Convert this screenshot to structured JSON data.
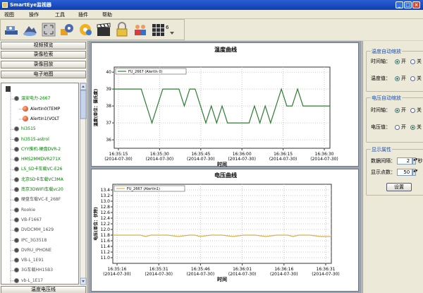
{
  "window": {
    "title": "SmartEye监视器",
    "minimize": "_",
    "maximize": "□",
    "close": "×"
  },
  "menu": [
    "视图",
    "操作",
    "工具",
    "插件",
    "帮助"
  ],
  "toolbar": {
    "icons": [
      "camera-icon",
      "cloud-icon",
      "fullscreen-icon",
      "gear-icon",
      "film-clapper-icon",
      "lock-icon",
      "users-icon",
      "grid-icon"
    ],
    "grid_badge": "6"
  },
  "nav": {
    "buttons": [
      "视频预览",
      "录像检索",
      "录像回放",
      "电子地图"
    ],
    "bottom_tab": "温度电压线"
  },
  "tree": {
    "items": [
      {
        "label": "",
        "kind": "pc",
        "color": "#000000",
        "indent": 0
      },
      {
        "label": "温安电力-2667",
        "kind": "cam",
        "color": "#008000",
        "indent": 1
      },
      {
        "label": "AlertIn0(TEMP",
        "kind": "alarm",
        "color": "#000000",
        "indent": 2
      },
      {
        "label": "AlertIn1(VOLT",
        "kind": "alarm",
        "color": "#000000",
        "indent": 2
      },
      {
        "label": "hi3515",
        "kind": "cam",
        "color": "#008000",
        "indent": 1
      },
      {
        "label": "hi3515-astrol",
        "kind": "cam",
        "color": "#008000",
        "indent": 1
      },
      {
        "label": "CYY推机-硬盘DVR-2",
        "kind": "cam",
        "color": "#008000",
        "indent": 1
      },
      {
        "label": "HMS2MMDVR271X",
        "kind": "cam",
        "color": "#008000",
        "indent": 1
      },
      {
        "label": "LS_SD卡车载VC-E26",
        "kind": "cam",
        "color": "#008000",
        "indent": 1
      },
      {
        "label": "北京SD卡车载VC3MA",
        "kind": "cam",
        "color": "#008000",
        "indent": 1
      },
      {
        "label": "南京3DWIFI车载vc20",
        "kind": "cam",
        "color": "#008000",
        "indent": 1
      },
      {
        "label": "硬盘车载VC-E_268F",
        "kind": "cam",
        "color": "#505050",
        "indent": 1
      },
      {
        "label": "Rookie",
        "kind": "cam",
        "color": "#505050",
        "indent": 1
      },
      {
        "label": "VB-F1667",
        "kind": "cam",
        "color": "#505050",
        "indent": 1
      },
      {
        "label": "DVDCMM_1629",
        "kind": "cam",
        "color": "#505050",
        "indent": 1
      },
      {
        "label": "IPC_3G3518",
        "kind": "cam",
        "color": "#505050",
        "indent": 1
      },
      {
        "label": "DVRU_IPHONE",
        "kind": "cam",
        "color": "#505050",
        "indent": 1
      },
      {
        "label": "VB-L_1E91",
        "kind": "cam",
        "color": "#505050",
        "indent": 1
      },
      {
        "label": "3G车载HH15B3",
        "kind": "cam",
        "color": "#505050",
        "indent": 1
      },
      {
        "label": "vb-L_1E17",
        "kind": "cam",
        "color": "#505050",
        "indent": 1
      }
    ]
  },
  "charts": {
    "temperature": {
      "title": "温度曲线",
      "xlabel": "时间",
      "ylabel": "温度(单位：摄氏度)",
      "legend": "FU_2667 (AlertIn 0)",
      "line_color": "#2e7d32"
    },
    "voltage": {
      "title": "电压曲线",
      "xlabel": "时间",
      "ylabel": "电压(单位：伏特)",
      "legend": "FU_2667 (AlertIn1)",
      "line_color": "#d8b24a"
    }
  },
  "chart_data": [
    {
      "type": "line",
      "title": "温度曲线",
      "xlabel": "时间",
      "ylabel": "温度(单位：摄氏度)",
      "ylim": [
        35.5,
        40.3
      ],
      "yticks": [
        36,
        37,
        38,
        39,
        40
      ],
      "xticks": [
        "16:35:15\n(2014-07-30)",
        "16:35:30\n(2014-07-30)",
        "16:35:45\n(2014-07-30)",
        "16:36:00\n(2014-07-30)",
        "16:36:15\n(2014-07-30)",
        "16:36:30\n(2014-07-30)"
      ],
      "xlim": [
        0,
        80
      ],
      "grid": true,
      "legend": "top-left",
      "series": [
        {
          "name": "FU_2667 (AlertIn 0)",
          "x": [
            0,
            10,
            14,
            16,
            18,
            20,
            24,
            26,
            28,
            30,
            32,
            34,
            36,
            38,
            40,
            42,
            44,
            46,
            48,
            50,
            52,
            54,
            56,
            58,
            60,
            62,
            64,
            66,
            68,
            70,
            72,
            76,
            80
          ],
          "y": [
            39,
            39,
            37,
            38,
            39,
            39,
            39,
            38,
            39,
            39,
            38,
            37,
            38,
            37,
            38,
            37,
            37,
            37,
            37,
            37,
            38,
            37,
            38,
            37,
            38,
            39,
            38,
            38,
            39,
            38,
            38,
            38,
            38
          ]
        }
      ]
    },
    {
      "type": "line",
      "title": "电压曲线",
      "xlabel": "时间",
      "ylabel": "电压(单位：伏特)",
      "ylim": [
        10.8,
        13.6
      ],
      "yticks": [
        11.0,
        11.2,
        11.4,
        11.6,
        11.8,
        12.0,
        12.2,
        12.4,
        12.6,
        12.8,
        13.0,
        13.2,
        13.4
      ],
      "xticks": [
        "16:35:16\n(2014-07-30)",
        "16:35:31\n(2014-07-30)",
        "16:35:46\n(2014-07-30)",
        "16:36:01\n(2014-07-30)",
        "16:36:16\n(2014-07-30)",
        "16:36:31\n(2014-07-30)"
      ],
      "xlim": [
        0,
        80
      ],
      "grid": true,
      "legend": "top-left",
      "series": [
        {
          "name": "FU_2667 (AlertIn1)",
          "x": [
            0,
            10,
            12,
            14,
            16,
            20,
            24,
            28,
            30,
            32,
            36,
            40,
            44,
            48,
            52,
            56,
            60,
            64,
            66,
            68,
            72,
            76,
            80
          ],
          "y": [
            11.8,
            11.8,
            11.75,
            11.8,
            11.8,
            11.8,
            11.75,
            11.8,
            11.8,
            11.75,
            11.8,
            11.8,
            11.75,
            11.8,
            11.8,
            11.75,
            11.8,
            11.8,
            11.75,
            11.8,
            11.8,
            11.75,
            11.75
          ]
        }
      ]
    }
  ],
  "right": {
    "temp_auto": {
      "label": "温度自动缩放",
      "rows": [
        {
          "label": "时间轴：",
          "on": "开",
          "off": "关",
          "selected": "on"
        },
        {
          "label": "温度值：",
          "on": "开",
          "off": "关",
          "selected": "on"
        }
      ]
    },
    "volt_auto": {
      "label": "电压自动缩放",
      "rows": [
        {
          "label": "时间轴：",
          "on": "开",
          "off": "关",
          "selected": "on"
        },
        {
          "label": "电压值：",
          "on": "开",
          "off": "关",
          "selected": "off"
        }
      ]
    },
    "display": {
      "label": "显示属性",
      "interval_label": "数据间隔：",
      "interval_value": "2",
      "interval_unit": "秒",
      "points_label": "显示点数：",
      "points_value": "50",
      "set_button": "设置"
    }
  }
}
